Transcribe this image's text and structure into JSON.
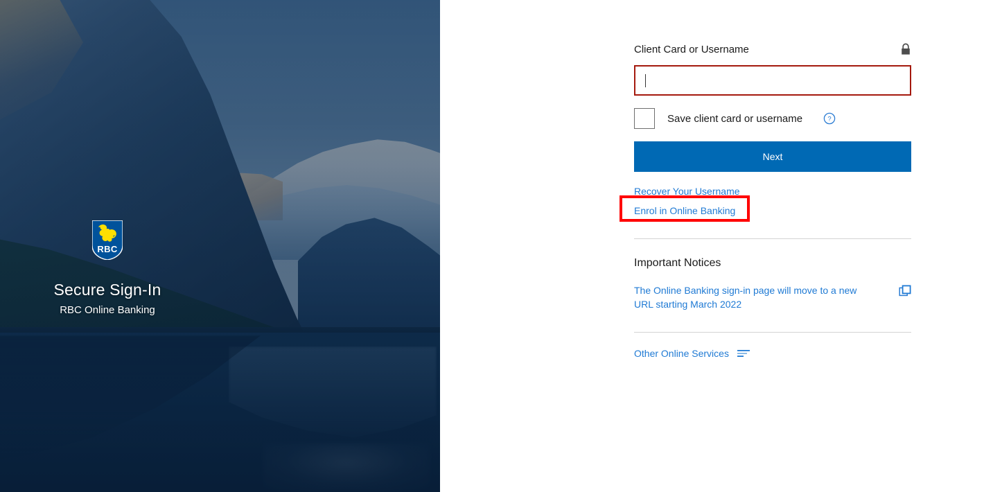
{
  "hero": {
    "logo_alt": "RBC",
    "logo_letters": "RBC",
    "title": "Secure Sign-In",
    "subtitle": "RBC Online Banking",
    "background_description": "Lake Louise mountain landscape at dusk with reflective lake",
    "colors": {
      "shield_blue": "#00529b",
      "lion_gold": "#fedf01",
      "overlay_blue": "#082a4e"
    }
  },
  "form": {
    "field_label": "Client Card or Username",
    "lock_icon": "lock-icon",
    "input_value": "",
    "input_placeholder": "",
    "input_border_color": "#a4190d",
    "checkbox_checked": false,
    "checkbox_label": "Save client card or username",
    "help_icon": "help-circle-icon",
    "next_label": "Next",
    "next_color": "#0069b4",
    "links": [
      {
        "label": "Recover Your Username",
        "highlighted": false
      },
      {
        "label": "Enrol in Online Banking",
        "highlighted": true
      }
    ],
    "link_color": "#1f7ad4"
  },
  "notices": {
    "section_title": "Important Notices",
    "items": [
      {
        "text": "The Online Banking sign-in page will move to a new URL starting March 2022",
        "icon": "open-in-new-window-icon"
      }
    ]
  },
  "services": {
    "label": "Other Online Services",
    "icon": "list-lines-icon"
  },
  "annotations": {
    "highlight_box_color": "#ff0000",
    "highlight_target": "Enrol in Online Banking",
    "arrow_color": "#ff0000",
    "arrow_direction": "up-right"
  }
}
